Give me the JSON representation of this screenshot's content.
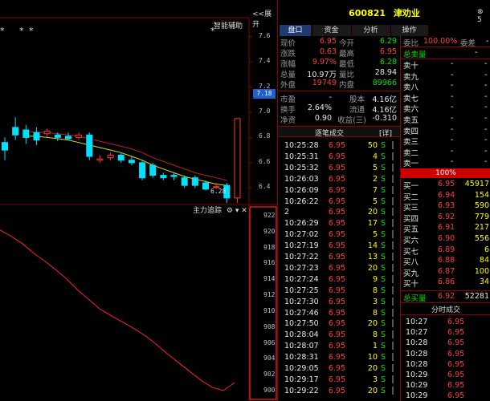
{
  "header": {
    "collapse_label": "<<展开",
    "smart_assist": "智能辅助",
    "stock_code": "600821",
    "stock_name": "津劝业",
    "window_close": "⊗ 5"
  },
  "tabs": [
    {
      "label": "盘口",
      "active": true
    },
    {
      "label": "资金",
      "active": false
    },
    {
      "label": "分析",
      "active": false
    },
    {
      "label": "操作",
      "active": false
    }
  ],
  "quote": [
    {
      "l1": "现价",
      "v1": "6.95",
      "c1": "red",
      "l2": "今开",
      "v2": "6.29",
      "c2": "green"
    },
    {
      "l1": "涨跌",
      "v1": "0.63",
      "c1": "red",
      "l2": "最高",
      "v2": "6.95",
      "c2": "red"
    },
    {
      "l1": "涨幅",
      "v1": "9.97%",
      "c1": "red",
      "l2": "最低",
      "v2": "6.28",
      "c2": "green"
    },
    {
      "l1": "总量",
      "v1": "10.97万",
      "c1": "white",
      "l2": "量比",
      "v2": "28.94",
      "c2": "white"
    },
    {
      "l1": "外盘",
      "v1": "19749",
      "c1": "red",
      "l2": "内盘",
      "v2": "89966",
      "c2": "green"
    }
  ],
  "fundamentals": [
    {
      "l1": "市盈",
      "v1": "-",
      "l2": "股本",
      "v2": "4.16亿"
    },
    {
      "l1": "换手",
      "v1": "2.64%",
      "l2": "流通",
      "v2": "4.16亿"
    },
    {
      "l1": "净资",
      "v1": "0.90",
      "l2": "收益(三)",
      "v2": "-0.310"
    }
  ],
  "trades_header": {
    "title": "逐笔成交",
    "detail": "[详]"
  },
  "trades": [
    {
      "time": "10:25:28",
      "price": "6.95",
      "vol": "50",
      "side": "S"
    },
    {
      "time": "10:25:31",
      "price": "6.95",
      "vol": "4",
      "side": "S"
    },
    {
      "time": "10:25:32",
      "price": "6.95",
      "vol": "5",
      "side": "S"
    },
    {
      "time": "10:26:03",
      "price": "6.95",
      "vol": "2",
      "side": "S"
    },
    {
      "time": "10:26:09",
      "price": "6.95",
      "vol": "7",
      "side": "S"
    },
    {
      "time": "10:26:22",
      "price": "6.95",
      "vol": "5",
      "side": "S"
    },
    {
      "time": "2",
      "price": "6.95",
      "vol": "20",
      "side": "S"
    },
    {
      "time": "10:26:29",
      "price": "6.95",
      "vol": "17",
      "side": "S"
    },
    {
      "time": "10:27:02",
      "price": "6.95",
      "vol": "5",
      "side": "S"
    },
    {
      "time": "10:27:19",
      "price": "6.95",
      "vol": "14",
      "side": "S"
    },
    {
      "time": "10:27:22",
      "price": "6.95",
      "vol": "13",
      "side": "S"
    },
    {
      "time": "10:27:23",
      "price": "6.95",
      "vol": "20",
      "side": "S"
    },
    {
      "time": "10:27:24",
      "price": "6.95",
      "vol": "9",
      "side": "S"
    },
    {
      "time": "10:27:25",
      "price": "6.95",
      "vol": "8",
      "side": "S"
    },
    {
      "time": "10:27:30",
      "price": "6.95",
      "vol": "3",
      "side": "S"
    },
    {
      "time": "10:27:46",
      "price": "6.95",
      "vol": "8",
      "side": "S"
    },
    {
      "time": "10:27:50",
      "price": "6.95",
      "vol": "20",
      "side": "S"
    },
    {
      "time": "10:28:04",
      "price": "6.95",
      "vol": "8",
      "side": "S"
    },
    {
      "time": "10:28:07",
      "price": "6.95",
      "vol": "1",
      "side": "S"
    },
    {
      "time": "10:28:31",
      "price": "6.95",
      "vol": "10",
      "side": "S"
    },
    {
      "time": "10:29:05",
      "price": "6.95",
      "vol": "20",
      "side": "S"
    },
    {
      "time": "10:29:17",
      "price": "6.95",
      "vol": "3",
      "side": "S"
    },
    {
      "time": "10:29:22",
      "price": "6.95",
      "vol": "20",
      "side": "S"
    }
  ],
  "committee": {
    "label1": "委比",
    "ratio": "100.00%",
    "label2": "委差",
    "diff": "-"
  },
  "total_sell": {
    "label": "总卖量",
    "value": "-"
  },
  "sell_levels": [
    "卖十",
    "卖九",
    "卖八",
    "卖七",
    "卖六",
    "卖五",
    "卖四",
    "卖三",
    "卖二",
    "卖一"
  ],
  "sell_placeholder": "-",
  "limit_bar": "100%",
  "buy_levels": [
    {
      "label": "买一",
      "price": "6.95",
      "vol": "45917"
    },
    {
      "label": "买二",
      "price": "6.94",
      "vol": "154"
    },
    {
      "label": "买三",
      "price": "6.93",
      "vol": "590"
    },
    {
      "label": "买四",
      "price": "6.92",
      "vol": "779"
    },
    {
      "label": "买五",
      "price": "6.91",
      "vol": "217"
    },
    {
      "label": "买六",
      "price": "6.90",
      "vol": "556"
    },
    {
      "label": "买七",
      "price": "6.89",
      "vol": "6"
    },
    {
      "label": "买八",
      "price": "6.88",
      "vol": "84"
    },
    {
      "label": "买九",
      "price": "6.87",
      "vol": "100"
    },
    {
      "label": "买十",
      "price": "6.86",
      "vol": "34"
    }
  ],
  "total_buy": {
    "label": "总买量",
    "price": "6.92",
    "vol": "52281"
  },
  "minute_title": "分时成交",
  "minute_trades": [
    {
      "time": "10:27",
      "price": "6.95"
    },
    {
      "time": "10:27",
      "price": "6.95"
    },
    {
      "time": "10:28",
      "price": "6.95"
    },
    {
      "time": "10:28",
      "price": "6.95"
    },
    {
      "time": "10:28",
      "price": "6.95"
    },
    {
      "time": "10:29",
      "price": "6.95"
    },
    {
      "time": "10:29",
      "price": "6.95"
    },
    {
      "time": "10:29",
      "price": "6.95"
    }
  ],
  "chart_data": [
    {
      "type": "candlestick",
      "y_ticks": [
        "7.6",
        "7.4",
        "7.2",
        "7.0",
        "6.8",
        "6.6",
        "6.4"
      ],
      "ylim": [
        6.3,
        7.7
      ],
      "current_marker": "7.18",
      "low_label": "6.28",
      "stars": [
        "*",
        "*",
        "*",
        "*"
      ],
      "candles": [
        {
          "o": 6.76,
          "c": 6.7,
          "h": 6.8,
          "l": 6.62
        },
        {
          "o": 6.88,
          "c": 6.82,
          "h": 6.96,
          "l": 6.78
        },
        {
          "o": 6.86,
          "c": 6.8,
          "h": 6.9,
          "l": 6.75
        },
        {
          "o": 6.84,
          "c": 6.78,
          "h": 6.88,
          "l": 6.74
        },
        {
          "o": 6.83,
          "c": 6.85,
          "h": 6.87,
          "l": 6.8
        },
        {
          "o": 6.82,
          "c": 6.8,
          "h": 6.84,
          "l": 6.77
        },
        {
          "o": 6.81,
          "c": 6.79,
          "h": 6.84,
          "l": 6.78
        },
        {
          "o": 6.8,
          "c": 6.82,
          "h": 6.84,
          "l": 6.78
        },
        {
          "o": 6.82,
          "c": 6.65,
          "h": 6.84,
          "l": 6.62
        },
        {
          "o": 6.62,
          "c": 6.63,
          "h": 6.66,
          "l": 6.6
        },
        {
          "o": 6.64,
          "c": 6.66,
          "h": 6.68,
          "l": 6.62
        },
        {
          "o": 6.66,
          "c": 6.62,
          "h": 6.68,
          "l": 6.6
        },
        {
          "o": 6.62,
          "c": 6.6,
          "h": 6.65,
          "l": 6.58
        },
        {
          "o": 6.6,
          "c": 6.48,
          "h": 6.62,
          "l": 6.46
        },
        {
          "o": 6.58,
          "c": 6.5,
          "h": 6.6,
          "l": 6.48
        },
        {
          "o": 6.5,
          "c": 6.48,
          "h": 6.52,
          "l": 6.46
        },
        {
          "o": 6.5,
          "c": 6.49,
          "h": 6.52,
          "l": 6.46
        },
        {
          "o": 6.48,
          "c": 6.42,
          "h": 6.5,
          "l": 6.4
        },
        {
          "o": 6.48,
          "c": 6.42,
          "h": 6.5,
          "l": 6.4
        },
        {
          "o": 6.44,
          "c": 6.39,
          "h": 6.46,
          "l": 6.38
        },
        {
          "o": 6.41,
          "c": 6.41,
          "h": 6.44,
          "l": 6.39
        },
        {
          "o": 6.42,
          "c": 6.32,
          "h": 6.44,
          "l": 6.28
        },
        {
          "o": 6.32,
          "c": 6.95,
          "h": 6.95,
          "l": 6.28
        }
      ],
      "ma1": [
        6.81,
        6.81,
        6.8,
        6.79,
        6.78,
        6.76,
        6.74,
        6.72,
        6.7,
        6.68,
        6.65,
        6.62,
        6.58,
        6.55,
        6.52,
        6.49,
        6.47,
        6.45,
        6.43,
        6.42
      ],
      "ma2": [
        6.85,
        6.84,
        6.84,
        6.83,
        6.82,
        6.81,
        6.79,
        6.77,
        6.75,
        6.73,
        6.71,
        6.68,
        6.64,
        6.61,
        6.58,
        6.55,
        6.52,
        6.5,
        6.48,
        6.46
      ]
    },
    {
      "type": "line",
      "title": "主力追踪",
      "y_ticks": [
        "922",
        "920",
        "918",
        "916",
        "914",
        "912",
        "910",
        "908",
        "906",
        "904",
        "902",
        "900"
      ],
      "ylim": [
        899.5,
        922.5
      ],
      "values": [
        920.2,
        919.4,
        918.5,
        917.3,
        916.3,
        915.2,
        914.0,
        912.6,
        911.4,
        910.2,
        909.4,
        908.6,
        907.8,
        906.9,
        905.8,
        904.6,
        903.5,
        902.4,
        901.3,
        900.4,
        900.0,
        901.0
      ]
    }
  ]
}
